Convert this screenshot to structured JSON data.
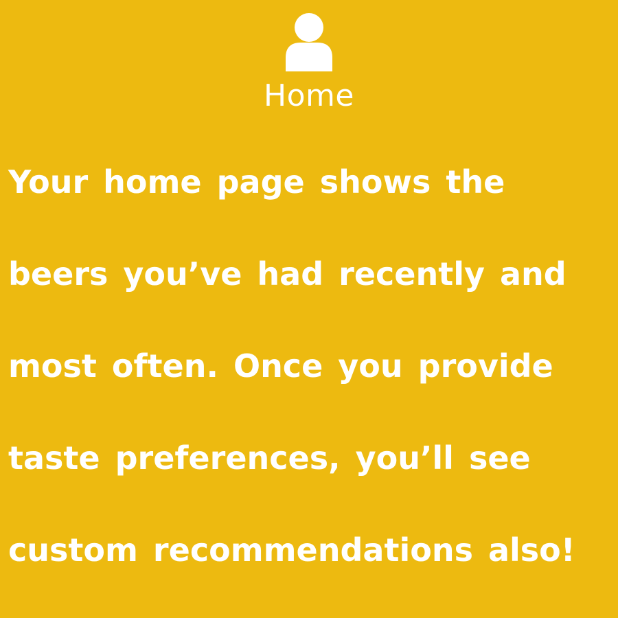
{
  "header": {
    "icon": "user-icon",
    "title": "Home"
  },
  "description": {
    "lines": [
      "Your home page shows the",
      "beers you’ve had recently and",
      "most often. Once you provide",
      "taste preferences, you’ll see",
      "custom recommendations also!"
    ]
  },
  "colors": {
    "background": "#EDBA10",
    "text": "#FFFFFF"
  }
}
